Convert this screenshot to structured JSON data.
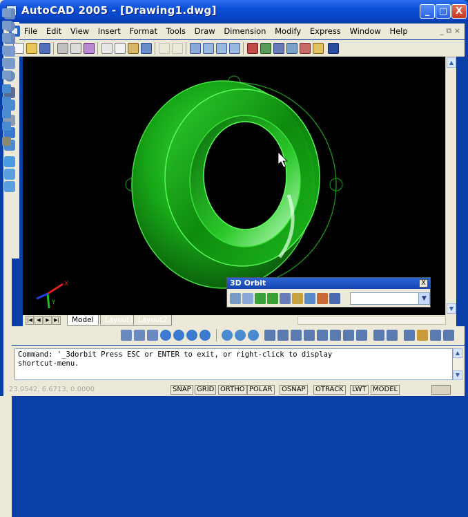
{
  "window": {
    "title": "AutoCAD 2005 - [Drawing1.dwg]",
    "min_label": "_",
    "max_label": "□",
    "close_label": "X"
  },
  "menu": {
    "items": [
      "File",
      "Edit",
      "View",
      "Insert",
      "Format",
      "Tools",
      "Draw",
      "Dimension",
      "Modify",
      "Express",
      "Window",
      "Help"
    ],
    "doc_controls": "_ ⧉ ×"
  },
  "tabs": {
    "model": "Model",
    "layout1": "Layout1",
    "layout2": "Layout2"
  },
  "command": {
    "text": "Command: '_3dorbit Press ESC or ENTER to exit, or right-click to display\nshortcut-menu."
  },
  "status": {
    "coords": "23.0542, 6.6713, 0.0000",
    "buttons": [
      "SNAP",
      "GRID",
      "ORTHO",
      "POLAR",
      "OSNAP",
      "OTRACK",
      "LWT",
      "MODEL"
    ]
  },
  "orbit_toolbar": {
    "title": "3D Orbit",
    "close_label": "X",
    "view_value": ""
  },
  "ucs": {
    "x_label": "X",
    "y_label": "Y"
  },
  "colors": {
    "title_blue": "#0a4ed8",
    "model_green": "#1fb01f",
    "viewport_bg": "#000000",
    "xp_face": "#ece9d8"
  }
}
